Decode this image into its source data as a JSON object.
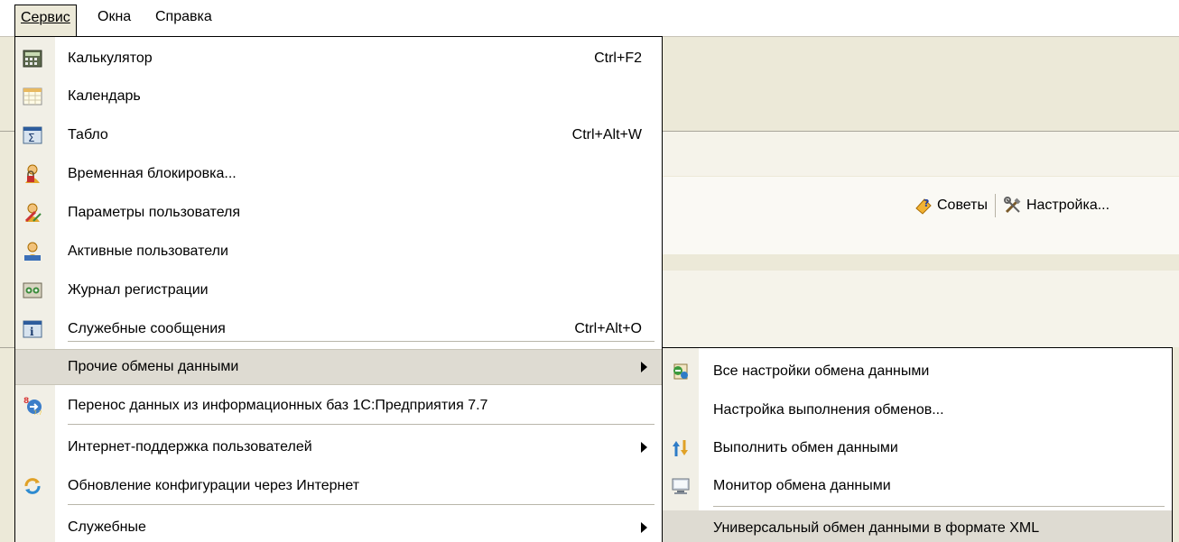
{
  "menubar": {
    "items": [
      "Сервис",
      "Окна",
      "Справка"
    ]
  },
  "toolbar": {
    "tips_label": "Советы",
    "settings_label": "Настройка..."
  },
  "service_menu": {
    "items": [
      {
        "label": "Калькулятор",
        "shortcut": "Ctrl+F2",
        "icon": "calculator-icon"
      },
      {
        "label": "Календарь",
        "shortcut": "",
        "icon": "calendar-icon"
      },
      {
        "label": "Табло",
        "shortcut": "Ctrl+Alt+W",
        "icon": "sum-board-icon"
      },
      {
        "label": "Временная блокировка...",
        "shortcut": "",
        "icon": "user-lock-icon"
      },
      {
        "label": "Параметры пользователя",
        "shortcut": "",
        "icon": "user-settings-icon"
      },
      {
        "label": "Активные пользователи",
        "shortcut": "",
        "icon": "active-users-icon"
      },
      {
        "label": "Журнал регистрации",
        "shortcut": "",
        "icon": "log-icon"
      },
      {
        "label": "Служебные сообщения",
        "shortcut": "Ctrl+Alt+O",
        "icon": "info-messages-icon"
      },
      {
        "label": "Прочие обмены данными",
        "shortcut": "",
        "icon": ""
      },
      {
        "label": "Перенос данных из информационных баз 1С:Предприятия 7.7",
        "shortcut": "",
        "icon": "data-transfer-77-icon"
      },
      {
        "label": "Интернет-поддержка пользователей",
        "shortcut": "",
        "icon": ""
      },
      {
        "label": "Обновление конфигурации через Интернет",
        "shortcut": "",
        "icon": "update-icon"
      },
      {
        "label": "Служебные",
        "shortcut": "",
        "icon": ""
      }
    ]
  },
  "exchange_submenu": {
    "items": [
      {
        "label": "Все настройки обмена данными",
        "icon": "exchange-settings-icon"
      },
      {
        "label": "Настройка выполнения обменов...",
        "icon": ""
      },
      {
        "label": "Выполнить обмен данными",
        "icon": "run-exchange-icon"
      },
      {
        "label": "Монитор обмена данными",
        "icon": "monitor-icon"
      },
      {
        "label": "Универсальный обмен данными в формате XML",
        "icon": ""
      }
    ]
  },
  "colors": {
    "menu_background": "#ffffff",
    "gutter": "#f1efe6",
    "highlight": "#dedbd2",
    "window_background": "#ece9d8"
  }
}
